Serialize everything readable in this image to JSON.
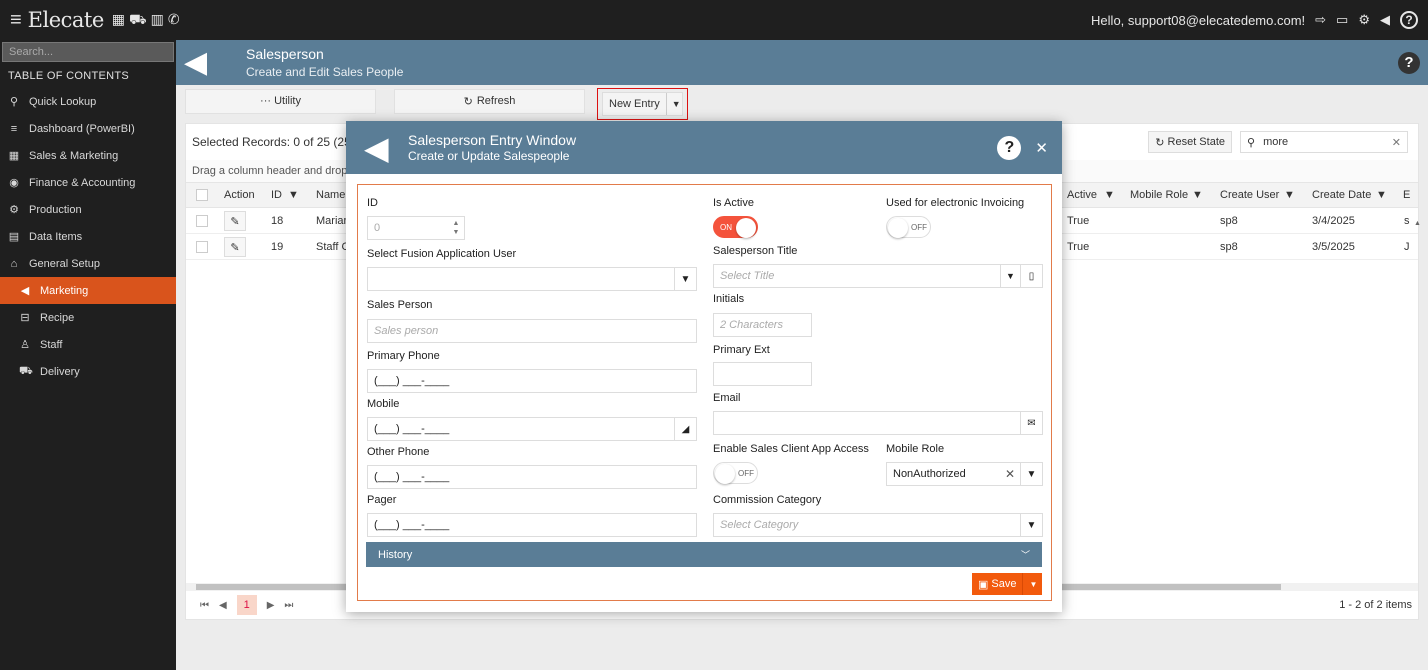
{
  "topbar": {
    "brand": "Elecate",
    "greeting": "Hello, support08@elecatedemo.com!"
  },
  "sidebar": {
    "search_placeholder": "Search...",
    "toc_title": "TABLE OF CONTENTS",
    "items": [
      {
        "label": "Quick Lookup",
        "icon": "search-icon"
      },
      {
        "label": "Dashboard (PowerBI)",
        "icon": "list-icon"
      },
      {
        "label": "Sales & Marketing",
        "icon": "chart-icon"
      },
      {
        "label": "Finance & Accounting",
        "icon": "coins-icon"
      },
      {
        "label": "Production",
        "icon": "gears-icon"
      },
      {
        "label": "Data Items",
        "icon": "file-icon"
      },
      {
        "label": "General Setup",
        "icon": "building-icon"
      },
      {
        "label": "Marketing",
        "icon": "megaphone-icon"
      },
      {
        "label": "Recipe",
        "icon": "basket-icon"
      },
      {
        "label": "Staff",
        "icon": "user-icon"
      },
      {
        "label": "Delivery",
        "icon": "truck-icon"
      }
    ]
  },
  "page": {
    "title": "Salesperson",
    "subtitle": "Create and Edit Sales People"
  },
  "toolbar": {
    "utility": "··· Utility",
    "refresh": "Refresh",
    "new_entry": "New Entry"
  },
  "grid": {
    "selected": "Selected Records: 0 of 25 (25",
    "group_hint": "Drag a column header and drop i",
    "reset_state": "Reset State",
    "search_value": "more",
    "headers": {
      "action": "Action",
      "id": "ID",
      "name": "Name",
      "active": "Active",
      "mobile_role": "Mobile Role",
      "create_user": "Create User",
      "create_date": "Create Date",
      "e": "E"
    },
    "rows": [
      {
        "id": "18",
        "name": "Marian",
        "active": "True",
        "create_user": "sp8",
        "create_date": "3/4/2025",
        "e": "s"
      },
      {
        "id": "19",
        "name": "Staff C",
        "active": "True",
        "create_user": "sp8",
        "create_date": "3/5/2025",
        "e": "J"
      }
    ],
    "page": "1",
    "count": "1 - 2 of 2 items"
  },
  "modal": {
    "title": "Salesperson Entry Window",
    "subtitle": "Create or Update Salespeople",
    "fields": {
      "id_label": "ID",
      "id_placeholder": "0",
      "fusion_user_label": "Select Fusion Application User",
      "sales_person_label": "Sales Person",
      "sales_person_placeholder": "Sales person",
      "primary_phone_label": "Primary Phone",
      "primary_phone_value": "(___) ___-____",
      "mobile_label": "Mobile",
      "mobile_value": "(___) ___-____",
      "other_phone_label": "Other Phone",
      "other_phone_value": "(___) ___-____",
      "pager_label": "Pager",
      "pager_value": "(___) ___-____",
      "is_active_label": "Is Active",
      "is_active_state": "ON",
      "einvoice_label": "Used for electronic Invoicing",
      "einvoice_state": "OFF",
      "title_label": "Salesperson Title",
      "title_placeholder": "Select Title",
      "initials_label": "Initials",
      "initials_placeholder": "2 Characters",
      "primary_ext_label": "Primary Ext",
      "email_label": "Email",
      "client_app_label": "Enable Sales Client App Access",
      "client_app_state": "OFF",
      "mobile_role_label": "Mobile Role",
      "mobile_role_value": "NonAuthorized",
      "commission_label": "Commission Category",
      "commission_placeholder": "Select Category"
    },
    "history": "History",
    "save": "Save"
  },
  "colors": {
    "header_blue": "#5a7d96",
    "accent_orange": "#f25a0d",
    "sidebar_bg": "#1f1f1f"
  }
}
